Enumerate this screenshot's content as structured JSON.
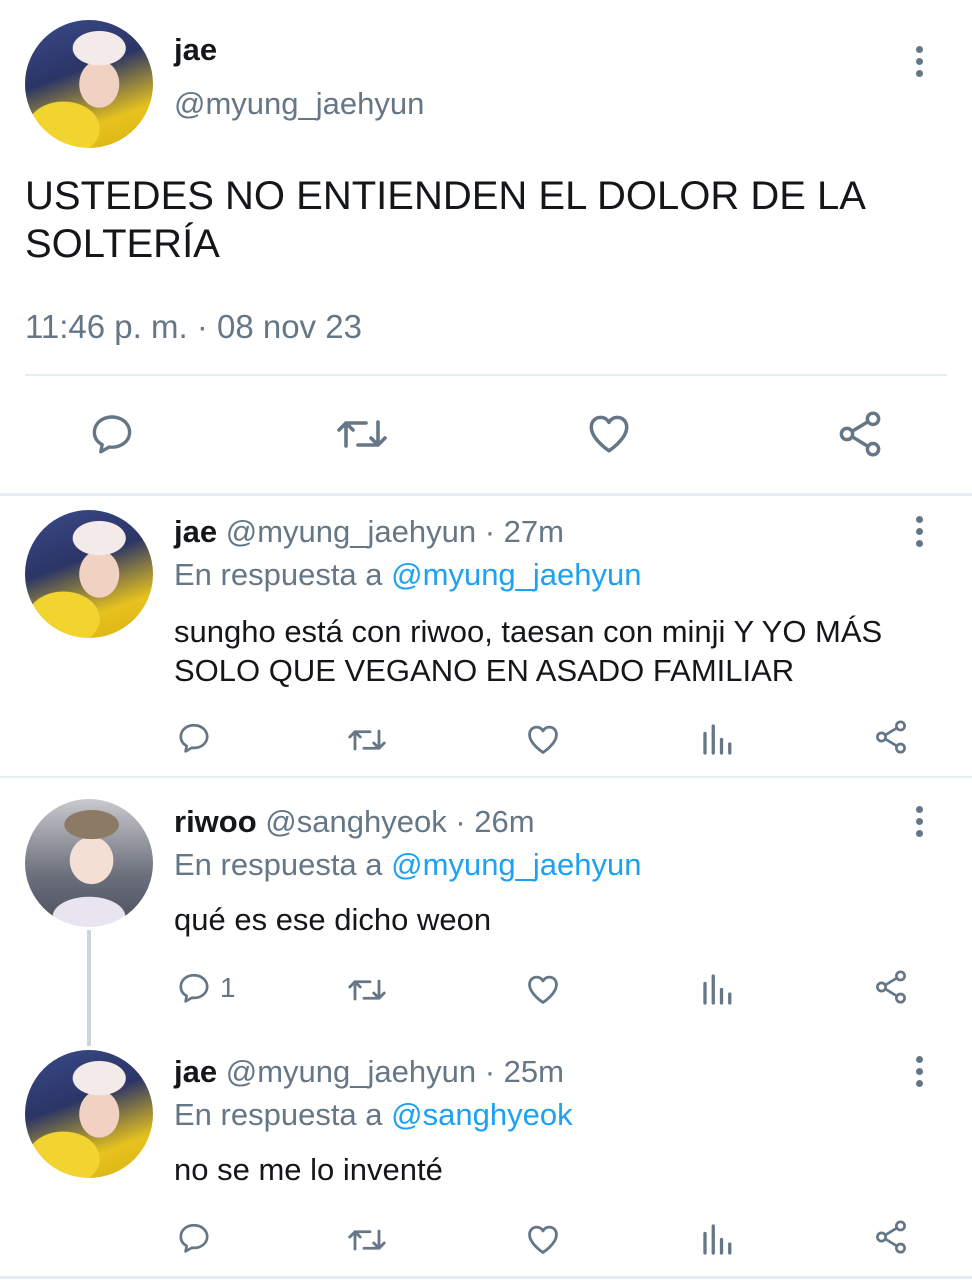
{
  "main_tweet": {
    "display_name": "jae",
    "handle": "@myung_jaehyun",
    "text": "USTEDES NO ENTIENDEN EL DOLOR DE LA SOLTERÍA",
    "timestamp": "11:46 p. m. · 08 nov 23"
  },
  "replies": [
    {
      "display_name": "jae",
      "meta": "@myung_jaehyun · 27m",
      "reply_prefix": "En respuesta a",
      "reply_to": "@myung_jaehyun",
      "text": "sungho está con riwoo, taesan con minji Y YO MÁS SOLO QUE VEGANO EN ASADO FAMILIAR",
      "reply_count": ""
    },
    {
      "display_name": "riwoo",
      "meta": "@sanghyeok · 26m",
      "reply_prefix": "En respuesta a",
      "reply_to": "@myung_jaehyun",
      "text": "qué es ese dicho weon",
      "reply_count": "1"
    },
    {
      "display_name": "jae",
      "meta": "@myung_jaehyun · 25m",
      "reply_prefix": "En respuesta a",
      "reply_to": "@sanghyeok",
      "text": "no se me lo inventé",
      "reply_count": ""
    }
  ],
  "icons": [
    "reply-icon",
    "retweet-icon",
    "like-icon",
    "views-icon",
    "share-icon",
    "more-icon"
  ],
  "colors": {
    "link": "#1da1f2",
    "muted": "#657786",
    "text": "#14171a",
    "divider": "#e6ecf0"
  }
}
